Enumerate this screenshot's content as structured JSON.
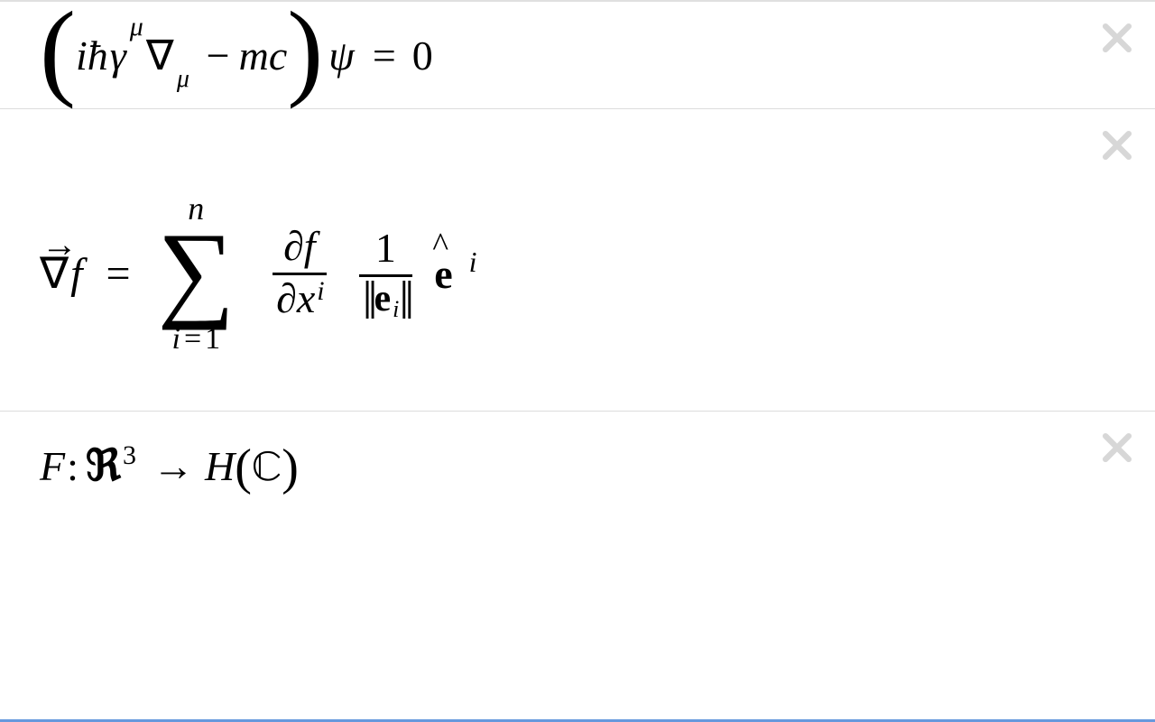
{
  "equations": [
    {
      "latex": "\\left(i\\hbar\\gamma^{\\mu}\\nabla_{\\mu} - mc\\right)\\psi = 0",
      "description": "Dirac equation form"
    },
    {
      "latex": "\\vec{\\nabla} f = \\sum_{i=1}^{n} \\frac{\\partial f}{\\partial x^{i}} \\, \\frac{1}{\\lVert \\mathbf{e}_{i} \\rVert} \\, \\hat{\\mathbf{e}}^{\\,i}",
      "description": "Gradient in general basis"
    },
    {
      "latex": "F\\colon \\mathfrak{R}^{3} \\to H(\\mathbb{C})",
      "description": "Mapping from R^3 to H(C)"
    }
  ],
  "glyphs": {
    "i": "i",
    "hbar": "ħ",
    "gamma": "γ",
    "mu": "μ",
    "nabla": "∇",
    "minus": "−",
    "m": "m",
    "c": "c",
    "psi": "ψ",
    "eq": "=",
    "zero": "0",
    "arrow_over": "→",
    "f": "f",
    "Sigma": "∑",
    "n": "n",
    "one": "1",
    "partial": "∂",
    "x": "x",
    "e": "e",
    "hat": "^",
    "F": "F",
    "colon": ":",
    "R_frak": "ℜ",
    "three": "3",
    "to": "→",
    "H": "H",
    "lp": "(",
    "rp": ")",
    "C_bb": "ℂ",
    "norm": "‖"
  },
  "ui": {
    "close_label": "Remove"
  }
}
